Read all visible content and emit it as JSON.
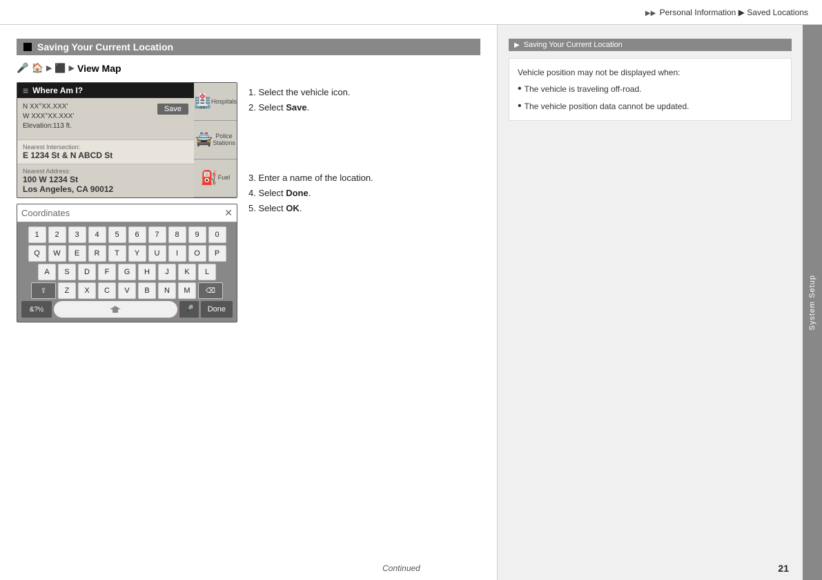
{
  "breadcrumb": {
    "arrows": "▶▶",
    "part1": "Personal Information",
    "separator": "▶",
    "part2": "Saved Locations"
  },
  "sidebar": {
    "label": "System Setup"
  },
  "section": {
    "title": "Saving Your Current Location"
  },
  "path": {
    "icon1": "🎤",
    "icon2": "🏠",
    "arrow1": "▶",
    "icon3": "➡",
    "arrow2": "▶",
    "icon4": "⬛",
    "arrow3": "▶",
    "label": "View Map"
  },
  "nav_screen": {
    "header_title": "Where Am I?",
    "coords_line1": "N XX°XX.XXX'",
    "coords_line2": "W XXX°XX.XXX'",
    "elevation": "Elevation:113 ft.",
    "save_btn": "Save",
    "nearest_intersection_label": "Nearest Intersection:",
    "nearest_intersection_value": "E 1234 St & N ABCD St",
    "nearest_address_label": "Nearest Address:",
    "nearest_address_line1": "100 W 1234 St",
    "nearest_address_line2": "Los Angeles, CA 90012",
    "poi1": "Hospitals",
    "poi2": "Police Stations",
    "poi3": "Fuel"
  },
  "keyboard_screen": {
    "input_placeholder": "Coordinates",
    "rows": {
      "numbers": [
        "1",
        "2",
        "3",
        "4",
        "5",
        "6",
        "7",
        "8",
        "9",
        "0"
      ],
      "row1": [
        "Q",
        "W",
        "E",
        "R",
        "T",
        "Y",
        "U",
        "I",
        "O",
        "P"
      ],
      "row2": [
        "A",
        "S",
        "D",
        "F",
        "G",
        "H",
        "J",
        "K",
        "L"
      ],
      "row3": [
        "Z",
        "X",
        "C",
        "V",
        "B",
        "N",
        "M"
      ],
      "symbols": "&?½",
      "done": "Done"
    }
  },
  "instructions": {
    "step1": "1. Select the vehicle icon.",
    "step2_prefix": "2. Select ",
    "step2_bold": "Save",
    "step2_suffix": ".",
    "step3": "3. Enter a name of the location.",
    "step4_prefix": "4. Select ",
    "step4_bold": "Done",
    "step4_suffix": ".",
    "step5_prefix": "5. Select ",
    "step5_bold": "OK",
    "step5_suffix": "."
  },
  "right_panel": {
    "title": "Saving Your Current Location",
    "intro": "Vehicle position may not be displayed when:",
    "bullet1": "The vehicle is traveling off-road.",
    "bullet2": "The vehicle position data cannot be updated."
  },
  "footer": {
    "continued": "Continued",
    "page": "21"
  }
}
